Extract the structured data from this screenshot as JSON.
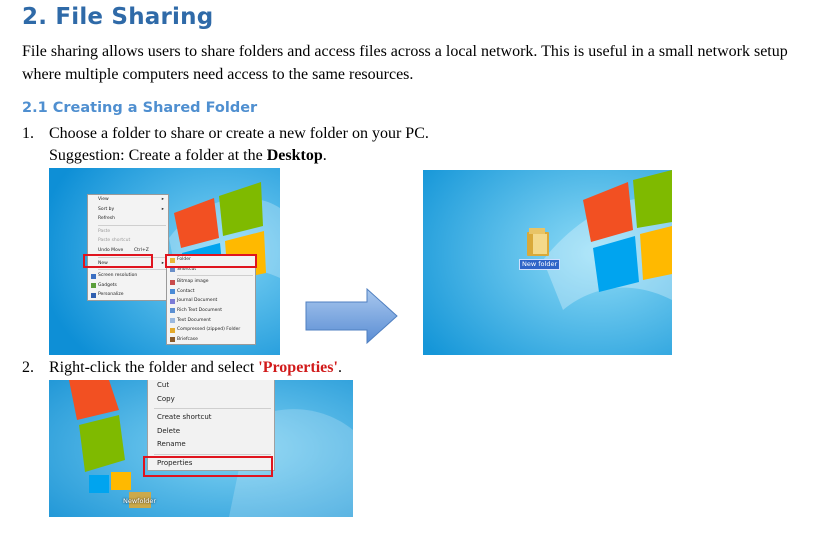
{
  "heading": "2. File Sharing",
  "intro": "File sharing allows users to share folders and access files across a local network. This is useful in a small network setup where multiple computers need access to the same resources.",
  "subheading": "2.1 Creating a Shared Folder",
  "steps": [
    {
      "num": "1.",
      "text": "Choose a folder to share or create a new folder on your PC.",
      "suggestion_prefix": "Suggestion: Create a folder at the ",
      "suggestion_bold": "Desktop",
      "suggestion_suffix": "."
    },
    {
      "num": "2.",
      "text_prefix": "Right-click the folder and select ",
      "text_highlight": "'Properties'",
      "text_suffix": "."
    }
  ],
  "desktop_menu": [
    {
      "label": "View",
      "arrow": "▸"
    },
    {
      "label": "Sort by",
      "arrow": "▸"
    },
    {
      "label": "Refresh"
    },
    {
      "label": "Paste",
      "gray": true
    },
    {
      "label": "Paste shortcut",
      "gray": true
    },
    {
      "label": "Undo Move",
      "shortcut": "Ctrl+Z"
    },
    {
      "label": "New",
      "arrow": "▸"
    },
    {
      "label": "Screen resolution"
    },
    {
      "label": "Gadgets"
    },
    {
      "label": "Personalize"
    }
  ],
  "new_submenu": [
    "Folder",
    "Shortcut",
    "Bitmap image",
    "Contact",
    "Journal Document",
    "Rich Text Document",
    "Text Document",
    "Compressed (zipped) Folder",
    "Briefcase"
  ],
  "new_folder_label": "New folder",
  "folder_menu": [
    "Cut",
    "Copy",
    "Create shortcut",
    "Delete",
    "Rename",
    "Properties"
  ],
  "folder_label_partial": "Newfolder",
  "colors": {
    "heading": "#2f6aa8",
    "subheading": "#4f8fd0",
    "highlight": "#d11a1a",
    "box": "#e0141e",
    "arrow": "#6b9bd8"
  }
}
